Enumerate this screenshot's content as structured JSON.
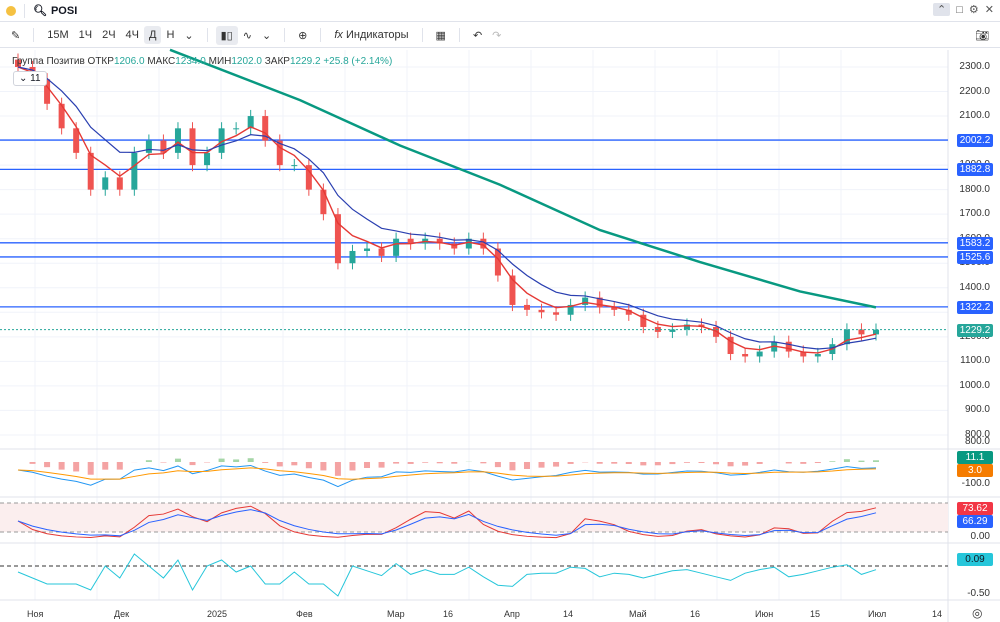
{
  "header": {
    "symbol": "POSI"
  },
  "toolbar": {
    "intervals": [
      "15М",
      "1Ч",
      "2Ч",
      "4Ч",
      "Д",
      "Н"
    ],
    "indicators_label": "Индикаторы"
  },
  "legend": {
    "name": "Группа Позитив",
    "open_label": "ОТКР",
    "open": "1206.0",
    "high_label": "МАКС",
    "high": "1234.0",
    "low_label": "МИН",
    "low": "1202.0",
    "close_label": "ЗАКР",
    "close": "1229.2",
    "change": "+25.8 (+2.14%)",
    "collapsed_count": "11"
  },
  "colors": {
    "up": "#26a69a",
    "down": "#ef5350",
    "hline": "#2962ff",
    "ma_fast": "#e53935",
    "ma_slow": "#2a3fb0",
    "ma_long": "#089981"
  },
  "chart_data": {
    "type": "candlestick",
    "price_ticks": [
      "2300.0",
      "2200.0",
      "2100.0",
      "2000.0",
      "1900.0",
      "1800.0",
      "1700.0",
      "1600.0",
      "1500.0",
      "1400.0",
      "1300.0",
      "1200.0",
      "1100.0",
      "1000.0",
      "900.0",
      "800.0"
    ],
    "ylim": [
      800,
      2300
    ],
    "x_labels": [
      "Ноя",
      "Дек",
      "2025",
      "Фев",
      "Мар",
      "16",
      "Апр",
      "14",
      "Май",
      "16",
      "Июн",
      "15",
      "Июл",
      "14"
    ],
    "closes": [
      2300,
      2250,
      2150,
      2050,
      1950,
      1800,
      1850,
      1800,
      1950,
      2000,
      1950,
      2050,
      1900,
      1950,
      2050,
      2050,
      2100,
      2000,
      1900,
      1900,
      1800,
      1700,
      1500,
      1550,
      1560,
      1530,
      1600,
      1580,
      1600,
      1580,
      1560,
      1600,
      1560,
      1450,
      1330,
      1310,
      1300,
      1290,
      1330,
      1360,
      1320,
      1310,
      1290,
      1240,
      1220,
      1230,
      1250,
      1240,
      1200,
      1130,
      1120,
      1140,
      1180,
      1140,
      1120,
      1130,
      1170,
      1230,
      1210,
      1229.2
    ],
    "long_ma": [
      2370,
      2165,
      1980,
      1820,
      1635,
      1505,
      1385,
      1320
    ],
    "horizontal_levels": [
      "2002.2",
      "1882.8",
      "1583.2",
      "1525.6",
      "1322.2"
    ],
    "last_price": "1229.2",
    "macd": {
      "ticks": [
        "800.0",
        "-100.0"
      ],
      "values": [
        "11.1",
        "3.0"
      ]
    },
    "stoch": {
      "ticks": [
        "0.00"
      ],
      "values": [
        "73.62",
        "66.29"
      ]
    },
    "osc": {
      "ticks": [
        "-0.50"
      ],
      "value": "0.09"
    }
  }
}
